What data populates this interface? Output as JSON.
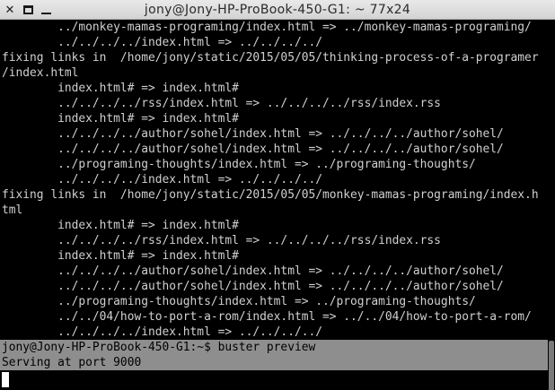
{
  "window": {
    "title": "jony@Jony-HP-ProBook-450-G1: ~ 77x24",
    "close_glyph": "✕"
  },
  "terminal": {
    "lines": [
      "        ../monkey-mamas-programing/index.html => ../monkey-mamas-programing/",
      "        ../../../../index.html => ../../../../",
      "fixing links in  /home/jony/static/2015/05/05/thinking-process-of-a-programer",
      "/index.html",
      "        index.html# => index.html#",
      "        ../../../../rss/index.html => ../../../../rss/index.rss",
      "        index.html# => index.html#",
      "        ../../../../author/sohel/index.html => ../../../../author/sohel/",
      "        ../../../../author/sohel/index.html => ../../../../author/sohel/",
      "        ../programing-thoughts/index.html => ../programing-thoughts/",
      "        ../../../../index.html => ../../../../",
      "fixing links in  /home/jony/static/2015/05/05/monkey-mamas-programing/index.h",
      "tml",
      "        index.html# => index.html#",
      "        ../../../../rss/index.html => ../../../../rss/index.rss",
      "        index.html# => index.html#",
      "        ../../../../author/sohel/index.html => ../../../../author/sohel/",
      "        ../../../../author/sohel/index.html => ../../../../author/sohel/",
      "        ../programing-thoughts/index.html => ../programing-thoughts/",
      "        ../../04/how-to-port-a-rom/index.html => ../../04/how-to-port-a-rom/",
      "        ../../../../index.html => ../../../../"
    ],
    "prompt_line": "jony@Jony-HP-ProBook-450-G1:~$ buster preview",
    "output_line": "Serving at port 9000"
  }
}
